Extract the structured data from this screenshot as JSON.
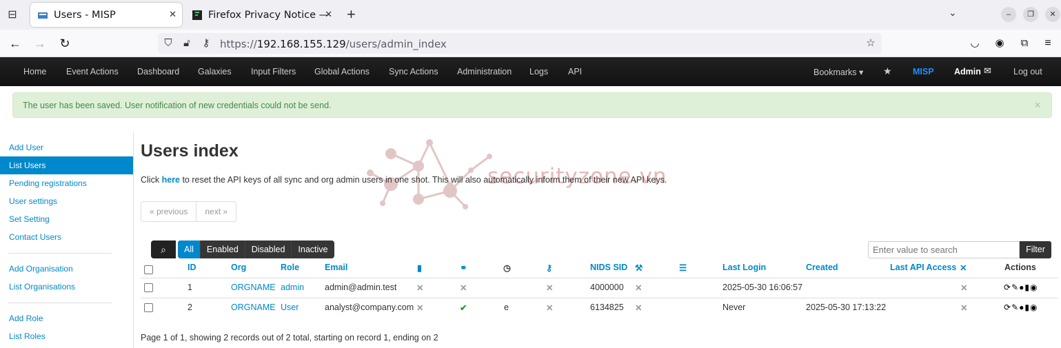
{
  "browser": {
    "tabs": [
      {
        "title": "Users - MISP",
        "active": true
      },
      {
        "title": "Firefox Privacy Notice —",
        "active": false
      }
    ],
    "url_prefix": "https://",
    "url_host": "192.168.155.129",
    "url_path": "/users/admin_index"
  },
  "misp_nav": {
    "items": [
      "Home",
      "Event Actions",
      "Dashboard",
      "Galaxies",
      "Input Filters",
      "Global Actions",
      "Sync Actions",
      "Administration",
      "Logs",
      "API"
    ],
    "bookmarks": "Bookmarks",
    "brand": "MISP",
    "user": "Admin",
    "logout": "Log out"
  },
  "alert": {
    "message": "The user has been saved. User notification of new credentials could not be send.",
    "close": "×"
  },
  "sidebar": {
    "items": [
      "Add User",
      "List Users",
      "Pending registrations",
      "User settings",
      "Set Setting",
      "Contact Users",
      "Add Organisation",
      "List Organisations",
      "Add Role",
      "List Roles"
    ],
    "active": "List Users"
  },
  "main": {
    "title": "Users index",
    "info_before": "Click ",
    "info_link": "here",
    "info_after": " to reset the API keys of all sync and org admin users in one shot. This will also automatically inform them of their new API keys.",
    "pager_prev": "« previous",
    "pager_next": "next »",
    "filters": [
      "All",
      "Enabled",
      "Disabled",
      "Inactive"
    ],
    "active_filter": "All",
    "search_placeholder": "Enter value to search",
    "filter_button": "Filter",
    "watermark": "securityzone.vn"
  },
  "table": {
    "headers": {
      "id": "ID",
      "org": "Org",
      "role": "Role",
      "email": "Email",
      "nids_sid": "NIDS SID",
      "last_login": "Last Login",
      "created": "Created",
      "last_api_access": "Last API Access",
      "actions": "Actions"
    },
    "rows": [
      {
        "id": "1",
        "org": "ORGNAME",
        "role": "admin",
        "email": "admin@admin.test",
        "c1": "✕",
        "c2": "✕",
        "c3": "",
        "c4": "✕",
        "nids_sid": "4000000",
        "c5": "✕",
        "last_login": "2025-05-30 16:06:57",
        "created": "",
        "api": "✕"
      },
      {
        "id": "2",
        "org": "ORGNAME",
        "role": "User",
        "email": "analyst@company.com",
        "c1": "✕",
        "c2": "✔",
        "c3": "e",
        "c4": "✕",
        "nids_sid": "6134825",
        "c5": "✕",
        "last_login": "Never",
        "created": "2025-05-30 17:13:22",
        "api": "✕"
      }
    ]
  },
  "footer": "Page 1 of 1, showing 2 records out of 2 total, starting on record 1, ending on 2"
}
